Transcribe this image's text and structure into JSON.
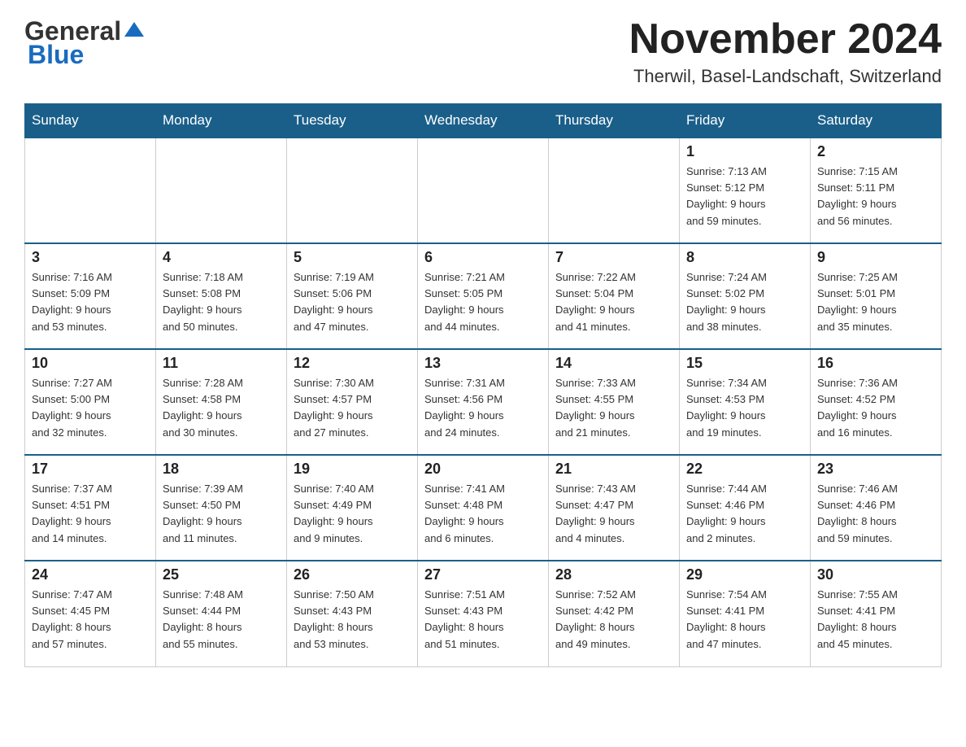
{
  "header": {
    "logo_general": "General",
    "logo_blue": "Blue",
    "month_title": "November 2024",
    "location": "Therwil, Basel-Landschaft, Switzerland"
  },
  "weekdays": [
    "Sunday",
    "Monday",
    "Tuesday",
    "Wednesday",
    "Thursday",
    "Friday",
    "Saturday"
  ],
  "weeks": [
    [
      {
        "day": "",
        "info": ""
      },
      {
        "day": "",
        "info": ""
      },
      {
        "day": "",
        "info": ""
      },
      {
        "day": "",
        "info": ""
      },
      {
        "day": "",
        "info": ""
      },
      {
        "day": "1",
        "info": "Sunrise: 7:13 AM\nSunset: 5:12 PM\nDaylight: 9 hours\nand 59 minutes."
      },
      {
        "day": "2",
        "info": "Sunrise: 7:15 AM\nSunset: 5:11 PM\nDaylight: 9 hours\nand 56 minutes."
      }
    ],
    [
      {
        "day": "3",
        "info": "Sunrise: 7:16 AM\nSunset: 5:09 PM\nDaylight: 9 hours\nand 53 minutes."
      },
      {
        "day": "4",
        "info": "Sunrise: 7:18 AM\nSunset: 5:08 PM\nDaylight: 9 hours\nand 50 minutes."
      },
      {
        "day": "5",
        "info": "Sunrise: 7:19 AM\nSunset: 5:06 PM\nDaylight: 9 hours\nand 47 minutes."
      },
      {
        "day": "6",
        "info": "Sunrise: 7:21 AM\nSunset: 5:05 PM\nDaylight: 9 hours\nand 44 minutes."
      },
      {
        "day": "7",
        "info": "Sunrise: 7:22 AM\nSunset: 5:04 PM\nDaylight: 9 hours\nand 41 minutes."
      },
      {
        "day": "8",
        "info": "Sunrise: 7:24 AM\nSunset: 5:02 PM\nDaylight: 9 hours\nand 38 minutes."
      },
      {
        "day": "9",
        "info": "Sunrise: 7:25 AM\nSunset: 5:01 PM\nDaylight: 9 hours\nand 35 minutes."
      }
    ],
    [
      {
        "day": "10",
        "info": "Sunrise: 7:27 AM\nSunset: 5:00 PM\nDaylight: 9 hours\nand 32 minutes."
      },
      {
        "day": "11",
        "info": "Sunrise: 7:28 AM\nSunset: 4:58 PM\nDaylight: 9 hours\nand 30 minutes."
      },
      {
        "day": "12",
        "info": "Sunrise: 7:30 AM\nSunset: 4:57 PM\nDaylight: 9 hours\nand 27 minutes."
      },
      {
        "day": "13",
        "info": "Sunrise: 7:31 AM\nSunset: 4:56 PM\nDaylight: 9 hours\nand 24 minutes."
      },
      {
        "day": "14",
        "info": "Sunrise: 7:33 AM\nSunset: 4:55 PM\nDaylight: 9 hours\nand 21 minutes."
      },
      {
        "day": "15",
        "info": "Sunrise: 7:34 AM\nSunset: 4:53 PM\nDaylight: 9 hours\nand 19 minutes."
      },
      {
        "day": "16",
        "info": "Sunrise: 7:36 AM\nSunset: 4:52 PM\nDaylight: 9 hours\nand 16 minutes."
      }
    ],
    [
      {
        "day": "17",
        "info": "Sunrise: 7:37 AM\nSunset: 4:51 PM\nDaylight: 9 hours\nand 14 minutes."
      },
      {
        "day": "18",
        "info": "Sunrise: 7:39 AM\nSunset: 4:50 PM\nDaylight: 9 hours\nand 11 minutes."
      },
      {
        "day": "19",
        "info": "Sunrise: 7:40 AM\nSunset: 4:49 PM\nDaylight: 9 hours\nand 9 minutes."
      },
      {
        "day": "20",
        "info": "Sunrise: 7:41 AM\nSunset: 4:48 PM\nDaylight: 9 hours\nand 6 minutes."
      },
      {
        "day": "21",
        "info": "Sunrise: 7:43 AM\nSunset: 4:47 PM\nDaylight: 9 hours\nand 4 minutes."
      },
      {
        "day": "22",
        "info": "Sunrise: 7:44 AM\nSunset: 4:46 PM\nDaylight: 9 hours\nand 2 minutes."
      },
      {
        "day": "23",
        "info": "Sunrise: 7:46 AM\nSunset: 4:46 PM\nDaylight: 8 hours\nand 59 minutes."
      }
    ],
    [
      {
        "day": "24",
        "info": "Sunrise: 7:47 AM\nSunset: 4:45 PM\nDaylight: 8 hours\nand 57 minutes."
      },
      {
        "day": "25",
        "info": "Sunrise: 7:48 AM\nSunset: 4:44 PM\nDaylight: 8 hours\nand 55 minutes."
      },
      {
        "day": "26",
        "info": "Sunrise: 7:50 AM\nSunset: 4:43 PM\nDaylight: 8 hours\nand 53 minutes."
      },
      {
        "day": "27",
        "info": "Sunrise: 7:51 AM\nSunset: 4:43 PM\nDaylight: 8 hours\nand 51 minutes."
      },
      {
        "day": "28",
        "info": "Sunrise: 7:52 AM\nSunset: 4:42 PM\nDaylight: 8 hours\nand 49 minutes."
      },
      {
        "day": "29",
        "info": "Sunrise: 7:54 AM\nSunset: 4:41 PM\nDaylight: 8 hours\nand 47 minutes."
      },
      {
        "day": "30",
        "info": "Sunrise: 7:55 AM\nSunset: 4:41 PM\nDaylight: 8 hours\nand 45 minutes."
      }
    ]
  ]
}
